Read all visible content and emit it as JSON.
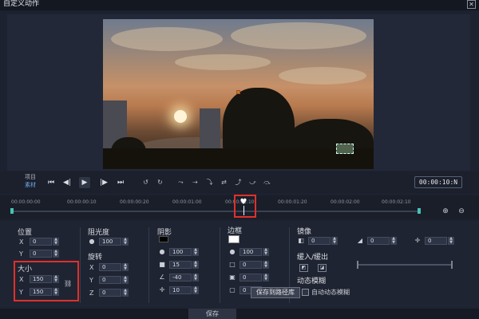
{
  "window": {
    "title": "自定义动作",
    "close_glyph": "✕"
  },
  "player": {
    "project_label": "项目",
    "clip_label": "素材",
    "buttons": {
      "start": "⏮",
      "prev_frame": "◀|",
      "play": "▶",
      "next_frame": "|▶",
      "end": "⏭"
    },
    "tools": [
      "↺",
      "↻",
      "⤳",
      "⇢",
      "⤵",
      "⇄",
      "⤴",
      "⤻",
      "⤼"
    ],
    "timecode": "00:00:10:N"
  },
  "timeline": {
    "ticks": [
      "00:00:00:00",
      "00:00:00:10",
      "00:00:00:20",
      "00:00:01:00",
      "00:00:01:10",
      "00:00:01:20",
      "00:00:02:00",
      "00:00:02:10"
    ],
    "playhead_glyph": "♥",
    "zoom_in": "⊕",
    "zoom_out": "⊖"
  },
  "props": {
    "position": {
      "label": "位置",
      "x_label": "X",
      "x": "0",
      "y_label": "Y",
      "y": "0"
    },
    "size": {
      "label": "大小",
      "x_label": "X",
      "x": "150",
      "y_label": "Y",
      "y": "150",
      "link_glyph": "⛓"
    },
    "opacity": {
      "label": "阻光度",
      "value": "100"
    },
    "rotation": {
      "label": "旋转",
      "x_label": "X",
      "x": "0",
      "y_label": "Y",
      "y": "0",
      "z_label": "Z",
      "z": "0"
    },
    "shadow": {
      "label": "阴影",
      "v1": "100",
      "v2": "15",
      "v3": "-40",
      "v4": "10"
    },
    "border": {
      "label": "边框",
      "v1": "100",
      "v2": "0",
      "v3": "0",
      "v4": "0"
    },
    "mirror": {
      "label": "镜像",
      "v1": "0",
      "v2": "0",
      "v3": "0"
    },
    "fade": {
      "label": "缓入/缓出"
    },
    "motion_blur": {
      "label": "动态模糊",
      "auto_label": "自动动态模糊"
    },
    "tooltip": "保存到路径库"
  },
  "footer": {
    "save_label": "保存"
  },
  "colors": {
    "highlight": "#e0302b",
    "accent": "#47c2b4",
    "link": "#6fa8e8"
  }
}
